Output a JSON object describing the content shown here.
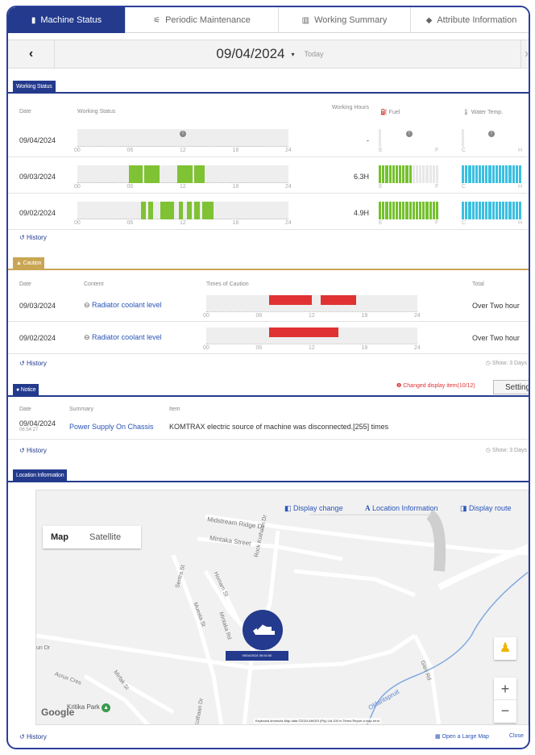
{
  "tabs": [
    {
      "label": "Machine Status",
      "icon": "document-icon",
      "active": true
    },
    {
      "label": "Periodic Maintenance",
      "icon": "wrench-icon"
    },
    {
      "label": "Working Summary",
      "icon": "bar-chart-icon"
    },
    {
      "label": "Attribute Information",
      "icon": "tag-icon"
    }
  ],
  "date_nav": {
    "date": "09/04/2024",
    "today": "Today",
    "prev": "‹",
    "next": "›",
    "caret": "▾"
  },
  "working_status": {
    "title": "Working Status",
    "headers": {
      "date": "Date",
      "status": "Working Status",
      "hours": "Working Hours",
      "fuel": "Fuel",
      "water": "Water Temp."
    },
    "ticks": [
      "00",
      "06",
      "12",
      "18",
      "24"
    ],
    "fuel_labels": [
      "E",
      "F"
    ],
    "water_labels": [
      "C",
      "H"
    ],
    "rows": [
      {
        "date": "09/04/2024",
        "hours": "-",
        "fuel_level": 0,
        "water_level": 0,
        "no_data": true,
        "segments": []
      },
      {
        "date": "09/03/2024",
        "hours": "6.3H",
        "fuel_level": 0.55,
        "water_level": 1.0,
        "no_data": false,
        "segments": [
          [
            5.9,
            7.4
          ],
          [
            7.6,
            9.3
          ],
          [
            11.4,
            13.1
          ],
          [
            13.3,
            14.5
          ]
        ]
      },
      {
        "date": "09/02/2024",
        "hours": "4.9H",
        "fuel_level": 1.0,
        "water_level": 1.0,
        "no_data": false,
        "segments": [
          [
            7.2,
            7.8
          ],
          [
            8.1,
            8.6
          ],
          [
            9.4,
            11.0
          ],
          [
            11.5,
            12.0
          ],
          [
            12.5,
            13.0
          ],
          [
            13.3,
            13.9
          ],
          [
            14.2,
            15.5
          ]
        ]
      }
    ],
    "history": "History"
  },
  "caution": {
    "title": "Caution",
    "headers": {
      "date": "Date",
      "content": "Content",
      "times": "Times of Caution",
      "total": "Total"
    },
    "ticks": [
      "00",
      "06",
      "12",
      "18",
      "24"
    ],
    "rows": [
      {
        "date": "09/03/2024",
        "content": "Radiator coolant level",
        "total": "Over Two hour",
        "segments": [
          [
            7.1,
            12.0
          ],
          [
            13.0,
            17.0
          ]
        ]
      },
      {
        "date": "09/02/2024",
        "content": "Radiator coolant level",
        "total": "Over Two hour",
        "segments": [
          [
            7.1,
            15.0
          ]
        ]
      }
    ],
    "history": "History",
    "show": "Show: 3 Days"
  },
  "notice": {
    "title": "Notice",
    "changed": "Changed display item(10/12)",
    "setting": "Setting",
    "headers": {
      "date": "Date",
      "summary": "Summary",
      "item": "Item"
    },
    "rows": [
      {
        "date": "09/04/2024",
        "time": "06:54:27",
        "summary": "Power Supply On Chassis",
        "item": "KOMTRAX electric source of machine was disconnected.[255] times"
      }
    ],
    "history": "History",
    "show": "Show: 3 Days"
  },
  "location": {
    "title": "Location Information",
    "tools": {
      "display_change": "Display change",
      "location_info": "Location Information",
      "display_route": "Display route"
    },
    "map_types": {
      "map": "Map",
      "satellite": "Satellite"
    },
    "streets": [
      "Midstream Ridge Dr",
      "Mintaka Street",
      "Rock Kothaan Dr",
      "Sentra St",
      "Muesta St",
      "Homam St",
      "Mintaka Rd",
      "Kothaan Dr",
      "Glen Rd",
      "Olifantspruit",
      "Acrux Cres",
      "Mirfak St",
      "un Dr",
      "Kritika Park"
    ],
    "marker_time": "09/04/2024 06:54:50",
    "google": "Google",
    "footer": "Keyboard shortcuts   Map data ©2024 AfriGIS (Pty) Ltd   100 m   Terms   Report a map error",
    "zoom_in": "+",
    "zoom_out": "−",
    "history": "History",
    "open_large": "Open a Large Map",
    "close": "Close"
  },
  "colors": {
    "navy": "#233a8d",
    "green": "#7fc234",
    "red": "#e03232",
    "cyan": "#3cbfe0",
    "gold": "#c9a653"
  }
}
